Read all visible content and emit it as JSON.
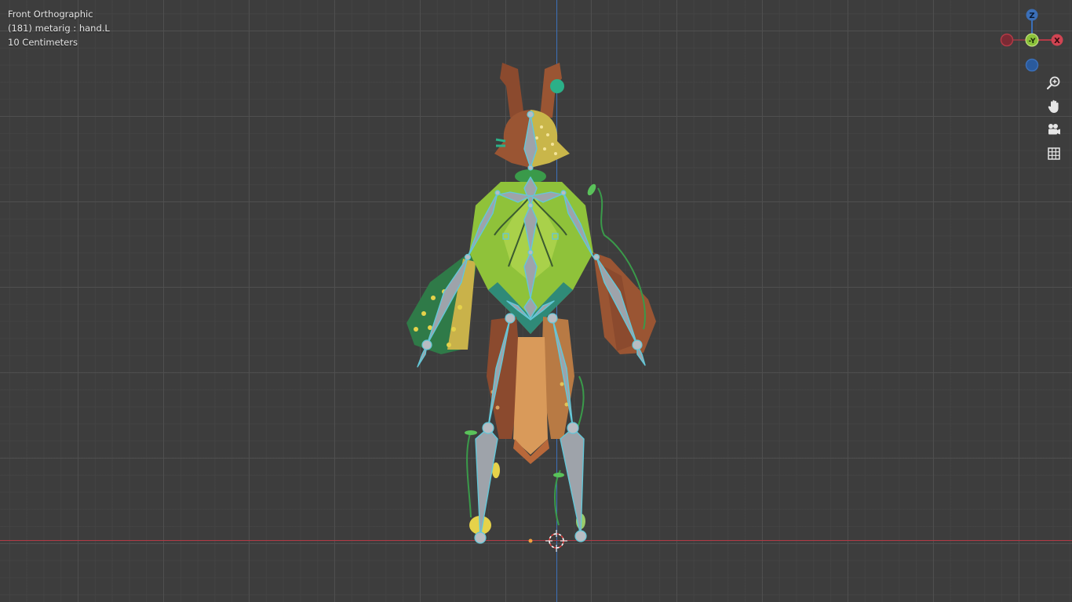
{
  "viewport": {
    "view_name": "Front Orthographic",
    "active_object": "(181) metarig : hand.L",
    "grid_scale": "10 Centimeters"
  },
  "gizmo": {
    "z_label": "Z",
    "x_label": "X",
    "y_label": "-Y"
  },
  "nav_buttons": [
    {
      "name": "zoom",
      "icon": "zoom-in-icon"
    },
    {
      "name": "pan",
      "icon": "hand-icon"
    },
    {
      "name": "camera",
      "icon": "camera-icon"
    },
    {
      "name": "ortho",
      "icon": "grid-icon"
    }
  ],
  "colors": {
    "background": "#3d3d3d",
    "z_axis": "#3b6fb8",
    "x_axis": "#b23a46",
    "y_axis": "#8bc23a",
    "bone_fill": "#9ea3aa",
    "bone_outline": "#63c7d8"
  }
}
